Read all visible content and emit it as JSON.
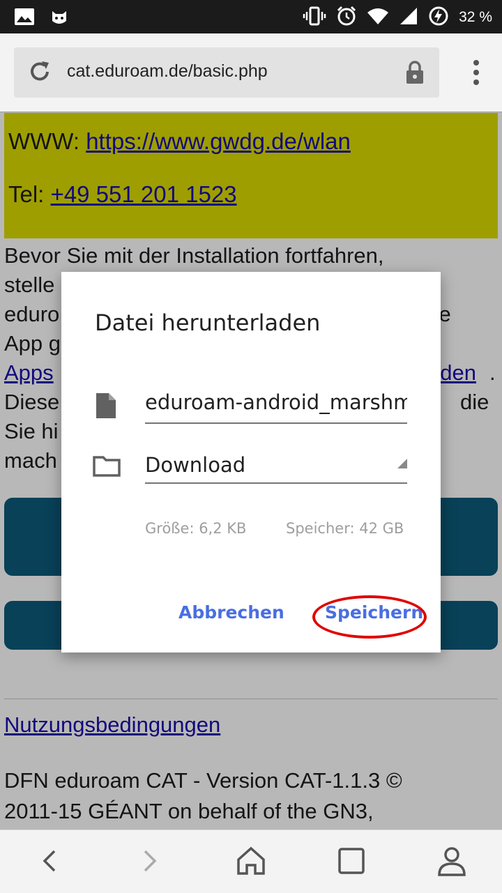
{
  "status_bar": {
    "battery_percent": "32 %",
    "icons": [
      "image-icon",
      "android-face-icon",
      "vibrate-icon",
      "alarm-icon",
      "wifi-icon",
      "signal-icon",
      "battery-charging-icon"
    ]
  },
  "browser": {
    "url": "cat.eduroam.de/basic.php"
  },
  "page": {
    "www_label": "WWW: ",
    "www_link": "https://www.gwdg.de/wlan",
    "tel_label": "Tel: ",
    "tel_link": "+49 551 201 1523",
    "para_line1": "Bevor Sie mit der Installation fortfahren,",
    "para_line2": "stelle",
    "para_line3a": "eduro",
    "para_line3b": "se",
    "para_line4": "App g",
    "para_line5a": "Apps",
    "para_line5b": "aden",
    "para_line5c": ".",
    "para_line6a": "Diese",
    "para_line6b": "die",
    "para_line7": "Sie hi",
    "para_line8": "mach",
    "terms_link": "Nutzungsbedingungen",
    "footer_line1": "DFN eduroam CAT - Version CAT-1.1.3 ©",
    "footer_line2": "2011-15 GÉANT on behalf of the GN3,"
  },
  "dialog": {
    "title": "Datei herunterladen",
    "filename": "eduroam-android_marshmallow",
    "folder": "Download",
    "size_text": "Größe: 6,2  KB",
    "storage_text": "Speicher: 42  GB",
    "cancel_label": "Abbrechen",
    "save_label": "Speichern",
    "highlight_color": "#e00000",
    "accent_color": "#4a6ee0"
  },
  "colors": {
    "contact_box": "#dcdc00",
    "install_button": "#0c5a7a",
    "link": "#1a0dab"
  }
}
